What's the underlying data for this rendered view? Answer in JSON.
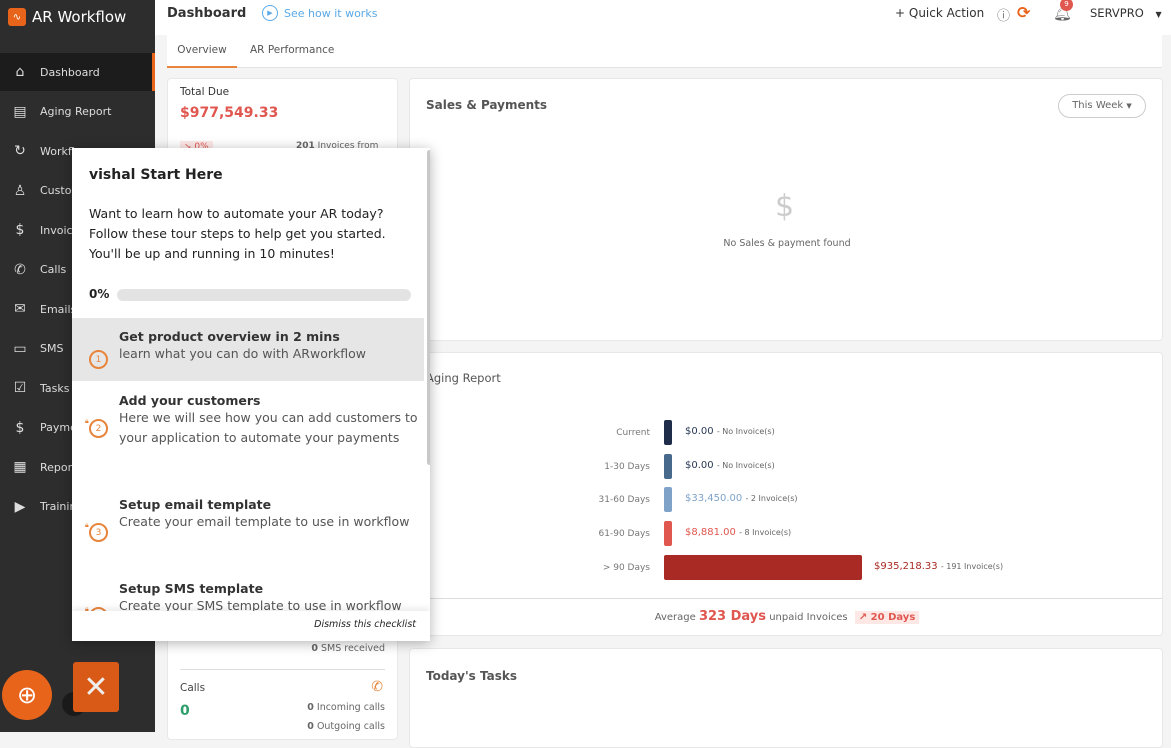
{
  "app": {
    "name": "AR Workflow",
    "logo_text": "Wn"
  },
  "sidebar": {
    "items": [
      {
        "label": "Dashboard",
        "icon": "home-icon",
        "glyph": "⌂"
      },
      {
        "label": "Aging Report",
        "icon": "chart-icon",
        "glyph": "▤"
      },
      {
        "label": "Workflow",
        "icon": "workflow-icon",
        "glyph": "↻"
      },
      {
        "label": "Customers",
        "icon": "user-icon",
        "glyph": "♙"
      },
      {
        "label": "Invoices",
        "icon": "invoice-icon",
        "glyph": "$"
      },
      {
        "label": "Calls",
        "icon": "phone-icon",
        "glyph": "✆"
      },
      {
        "label": "Emails",
        "icon": "mail-icon",
        "glyph": "✉"
      },
      {
        "label": "SMS",
        "icon": "sms-icon",
        "glyph": "▭"
      },
      {
        "label": "Tasks",
        "icon": "tasks-icon",
        "glyph": "☑"
      },
      {
        "label": "Payments",
        "icon": "dollar-icon",
        "glyph": "$"
      },
      {
        "label": "Reports",
        "icon": "report-icon",
        "glyph": "▦"
      },
      {
        "label": "Training",
        "icon": "play-icon",
        "glyph": "▶"
      }
    ]
  },
  "header": {
    "title": "Dashboard",
    "see_how": "See how it works",
    "quick_action": "+ Quick Action",
    "notifications": "9",
    "user": "SERVPRO"
  },
  "tabs": [
    "Overview",
    "AR Performance"
  ],
  "total_due": {
    "label": "Total Due",
    "amount": "$977,549.33",
    "change": "↘ 0%",
    "invoices_count": "201",
    "invoices_text": "Invoices from"
  },
  "sms": {
    "received_count": "0",
    "received_label": "SMS received"
  },
  "calls": {
    "label": "Calls",
    "total": "0",
    "incoming_count": "0",
    "incoming_label": "Incoming calls",
    "outgoing_count": "0",
    "outgoing_label": "Outgoing calls"
  },
  "sales": {
    "title": "Sales & Payments",
    "filter": "This Week",
    "empty": "No Sales & payment found"
  },
  "aging": {
    "title": "Aging Report",
    "rows": [
      {
        "label": "Current",
        "amount": "$0.00",
        "value": 0,
        "invoices": "- No Invoice(s)",
        "color": "#1f2d4a"
      },
      {
        "label": "1-30 Days",
        "amount": "$0.00",
        "value": 0,
        "invoices": "- No Invoice(s)",
        "color": "#476a8c"
      },
      {
        "label": "31-60 Days",
        "amount": "$33,450.00",
        "value": 33450,
        "invoices": "- 2 Invoice(s)",
        "color": "#7fa3c8"
      },
      {
        "label": "61-90 Days",
        "amount": "$8,881.00",
        "value": 8881,
        "invoices": "- 8 Invoice(s)",
        "color": "#e0574f"
      },
      {
        "label": "> 90 Days",
        "amount": "$935,218.33",
        "value": 935218.33,
        "invoices": "- 191 Invoice(s)",
        "color": "#a92a24"
      }
    ],
    "avg_prefix": "Average",
    "avg_days": "323 Days",
    "avg_suffix": "unpaid Invoices",
    "avg_change": "↗ 20 Days"
  },
  "tasks": {
    "title": "Today's Tasks"
  },
  "checklist": {
    "title": "vishal Start Here",
    "intro": "Want to learn how to automate your AR today? Follow these tour steps to help get you started. You'll be up and running in 10 minutes!",
    "progress_label": "0%",
    "progress": 0,
    "steps": [
      {
        "n": "1",
        "title": "Get product overview in 2 mins",
        "desc": "learn what you can do with ARworkflow",
        "locked": false
      },
      {
        "n": "2",
        "title": "Add your customers",
        "desc": "Here we will see how you can add customers to your application to automate your payments",
        "locked": true
      },
      {
        "n": "3",
        "title": "Setup email template",
        "desc": "Create your email template to use in workflow",
        "locked": true
      },
      {
        "n": "4",
        "title": "Setup SMS template",
        "desc": "Create your SMS template to use in workflow",
        "locked": true
      }
    ],
    "dismiss": "Dismiss this checklist"
  },
  "colors": {
    "accent": "#e8641b",
    "danger": "#e0574f",
    "success": "#2e9e6a",
    "sidebar": "#2d2d2d"
  }
}
